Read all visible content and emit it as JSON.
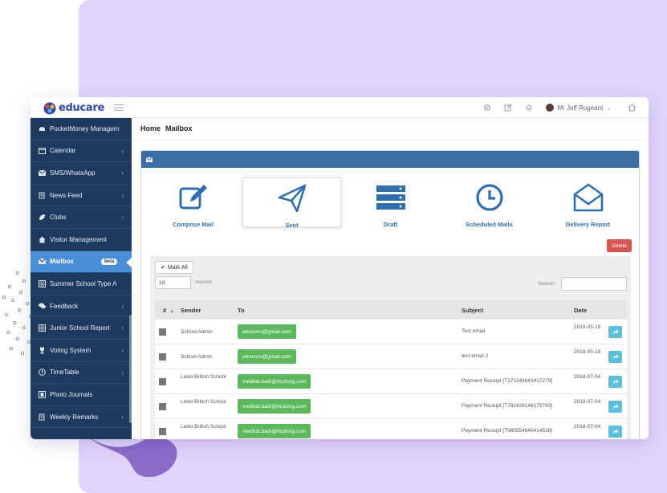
{
  "app": {
    "logo_text": "educare"
  },
  "header": {
    "user_name": "Mr Jeff Rogeant",
    "icons": [
      "settings-icon",
      "edit-icon",
      "bell-icon",
      "home-icon"
    ]
  },
  "sidebar": {
    "items": [
      {
        "label": "PocketMoney Managem",
        "icon": "wallet-icon",
        "chevron": ""
      },
      {
        "label": "Calendar",
        "icon": "calendar-icon",
        "chevron": "‹"
      },
      {
        "label": "SMS/WhatsApp",
        "icon": "envelope-icon",
        "chevron": "‹"
      },
      {
        "label": "News Feed",
        "icon": "news-icon",
        "chevron": "‹"
      },
      {
        "label": "Clubs",
        "icon": "leaf-icon",
        "chevron": "‹"
      },
      {
        "label": "Visitor Management",
        "icon": "home-icon",
        "chevron": ""
      },
      {
        "label": "Mailbox",
        "icon": "envelope-icon",
        "chevron": "",
        "badge": "beta",
        "active": true
      },
      {
        "label": "Summer School Type A",
        "icon": "grid-icon",
        "chevron": ""
      },
      {
        "label": "Feedback",
        "icon": "chat-icon",
        "chevron": "‹"
      },
      {
        "label": "Junior School Report",
        "icon": "grid-icon",
        "chevron": "‹"
      },
      {
        "label": "Voting System",
        "icon": "trophy-icon",
        "chevron": "‹"
      },
      {
        "label": "TimeTable",
        "icon": "clock-icon",
        "chevron": "‹"
      },
      {
        "label": "Photo Journals",
        "icon": "film-icon",
        "chevron": ""
      },
      {
        "label": "Weekly Remarks",
        "icon": "news-icon",
        "chevron": "‹"
      }
    ]
  },
  "breadcrumb": {
    "home": "Home",
    "current": "Mailbox"
  },
  "tiles": [
    {
      "label": "Compose Mail",
      "icon": "compose-icon"
    },
    {
      "label": "Sent",
      "icon": "paper-plane-icon",
      "selected": true
    },
    {
      "label": "Draft",
      "icon": "server-icon"
    },
    {
      "label": "Scheduled Mails",
      "icon": "clock-icon"
    },
    {
      "label": "Delivery Report",
      "icon": "open-envelope-icon"
    }
  ],
  "actions": {
    "delete": "Delete",
    "mark_all": "Mark All"
  },
  "controls": {
    "records_value": "10",
    "records_label": "records",
    "search_label": "Search:"
  },
  "table": {
    "headers": [
      "#",
      "Sender",
      "To",
      "Subject",
      "Date"
    ],
    "rows": [
      {
        "sender": "School Admin",
        "to": "winexviv@gmail.com",
        "subject": "Test email",
        "date": "2018-05-18"
      },
      {
        "sender": "School Admin",
        "to": "winexviv@gmail.com",
        "subject": "test email 2",
        "date": "2018-05-18"
      },
      {
        "sender": "Lekki British School",
        "to": "medhat.badr@itcplcng.com",
        "subject": "Payment Receipt [T371248643437279]",
        "date": "2018-07-04"
      },
      {
        "sender": "Lekki British School",
        "to": "medhat.badr@itcplcng.com",
        "subject": "Payment Receipt [T781429146179763]",
        "date": "2018-07-04"
      },
      {
        "sender": "Lekki British School",
        "to": "medhat.badr@itcplcng.com",
        "subject": "Payment Receipt [T980554840414538]",
        "date": "2018-07-04"
      }
    ]
  },
  "colors": {
    "sidebar": "#1e3a5e",
    "active": "#4a90d9",
    "accent": "#3a6ea5",
    "green": "#5cb85c",
    "red": "#d9534f",
    "lilac": "#e1d4fb"
  }
}
